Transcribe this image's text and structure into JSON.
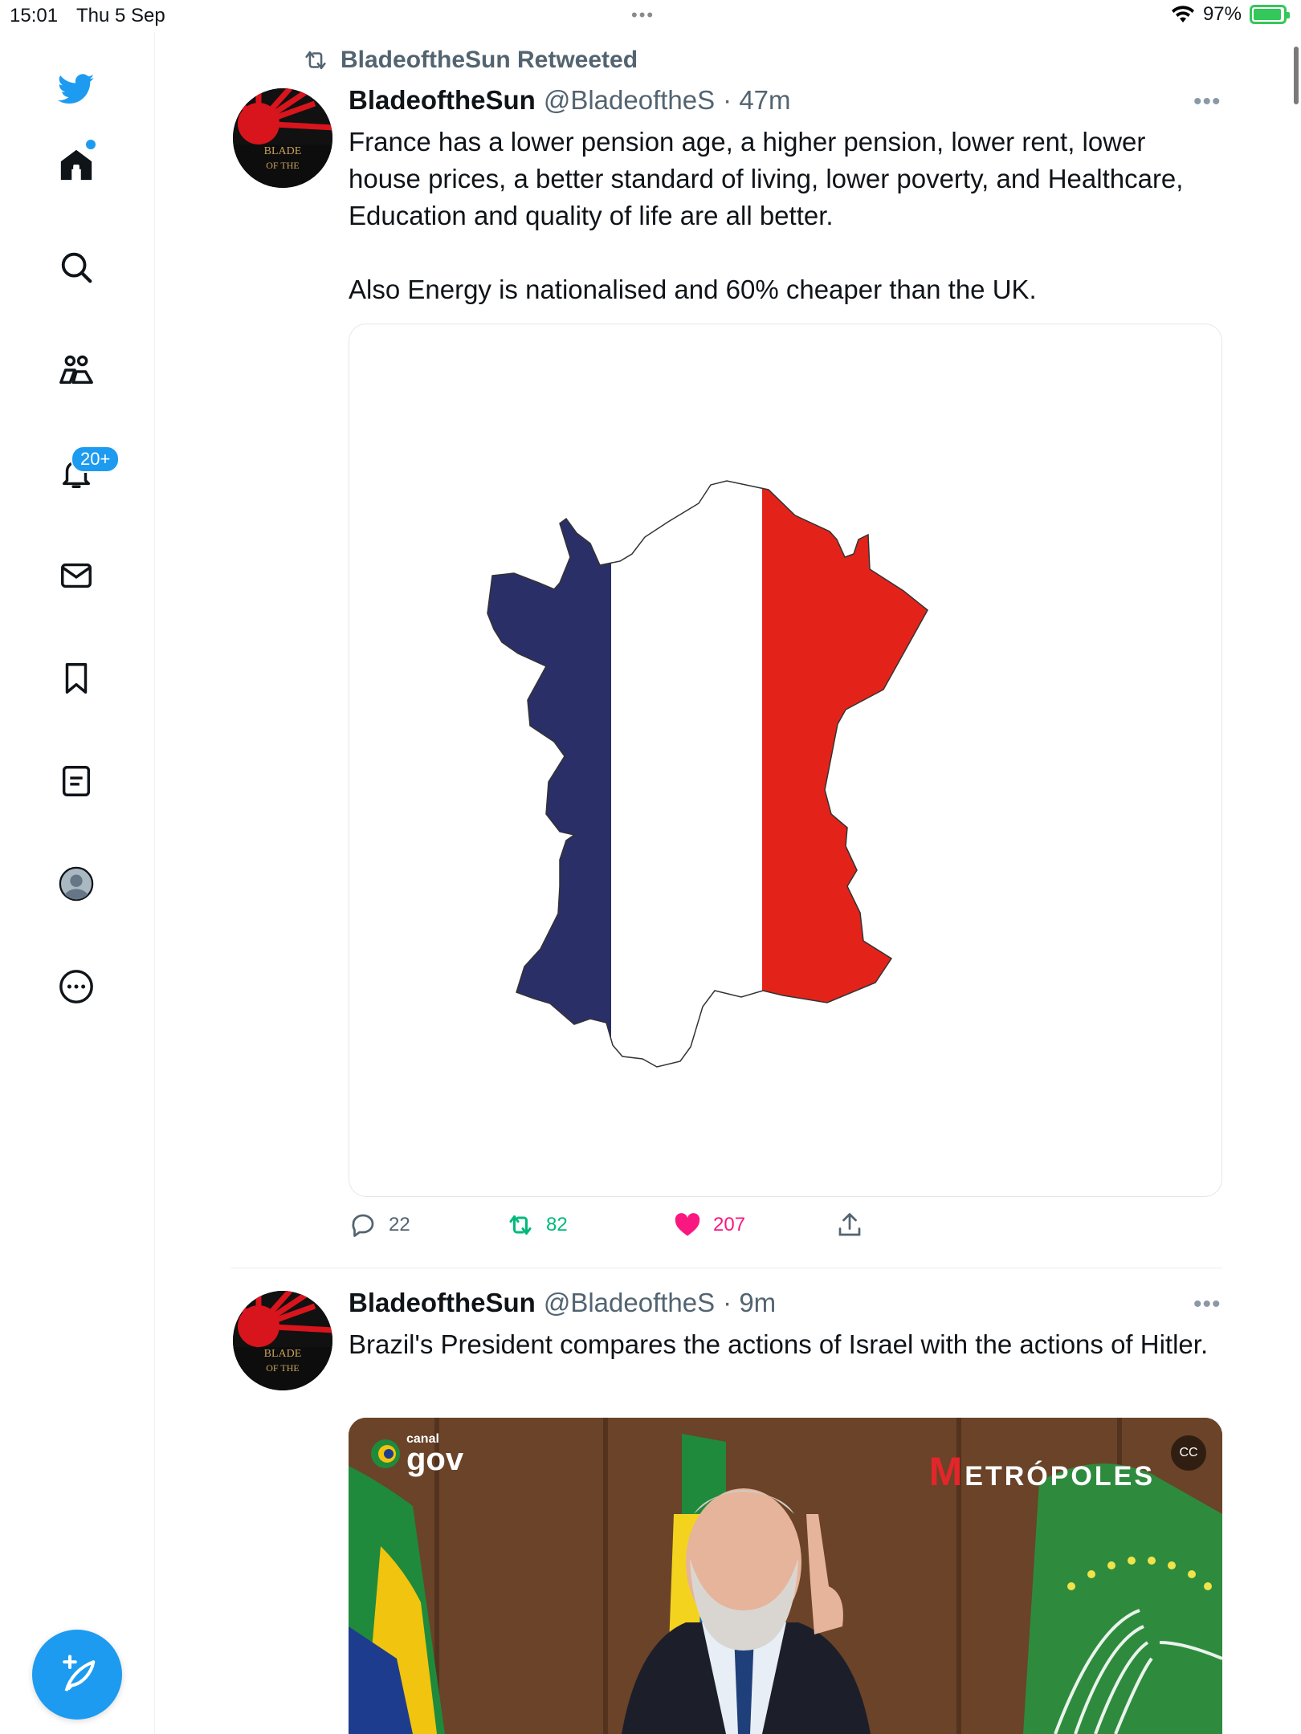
{
  "status_bar": {
    "time": "15:01",
    "date": "Thu 5 Sep",
    "battery": "97%"
  },
  "sidebar": {
    "notifications_badge": "20+",
    "items": [
      "twitter-logo",
      "home-icon",
      "search-icon",
      "communities-icon",
      "notifications-icon",
      "messages-icon",
      "bookmarks-icon",
      "lists-icon",
      "profile-icon",
      "more-icon"
    ]
  },
  "colors": {
    "accent": "#1d9bf0",
    "retweet_green": "#00ba7c",
    "like_pink": "#f91880",
    "france_blue": "#2b2f68",
    "france_red": "#e3231a"
  },
  "tweets": [
    {
      "retweeted_by": "BladeoftheSun Retweeted",
      "name": "BladeoftheSun",
      "handle": "@BladeoftheS",
      "time": "· 47m",
      "more": "•••",
      "text": "France has a lower pension age, a higher pension, lower rent, lower house prices, a better standard of living, lower poverty, and Healthcare, Education and quality of life are all better.\n\nAlso Energy is nationalised and 60% cheaper than the UK.",
      "replies": "22",
      "retweets": "82",
      "likes": "207"
    },
    {
      "name": "BladeoftheSun",
      "handle": "@BladeoftheS",
      "time": "· 9m",
      "more": "•••",
      "text": "Brazil's President compares the actions of Israel with the actions of Hitler.",
      "video": {
        "canal_small": "canal",
        "canal_big": "gov",
        "metropoles_m": "M",
        "metropoles_rest": "ETRÓPOLES"
      }
    }
  ]
}
